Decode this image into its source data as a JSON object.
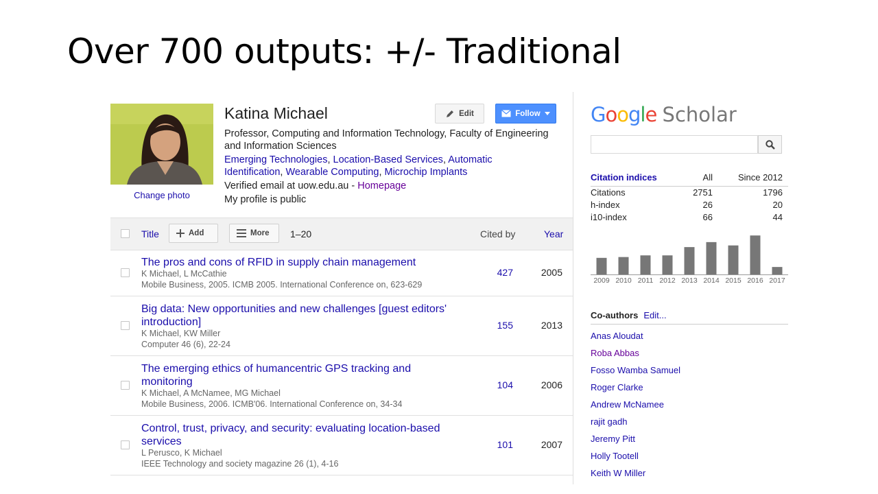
{
  "slide": {
    "title": "Over 700 outputs: +/- Traditional"
  },
  "profile": {
    "name": "Katina Michael",
    "affiliation": "Professor, Computing and Information Technology, Faculty of Engineering and Information Sciences",
    "interests": [
      "Emerging Technologies",
      "Location-Based Services",
      "Automatic Identification",
      "Wearable Computing",
      "Microchip Implants"
    ],
    "email": "Verified email at uow.edu.au",
    "email_sep": " - ",
    "homepage": "Homepage",
    "public_status": "My profile is public",
    "change_photo": "Change photo",
    "edit_label": "Edit",
    "follow_label": "Follow"
  },
  "toolbar": {
    "title_label": "Title",
    "add_label": "Add",
    "more_label": "More",
    "range": "1–20",
    "cited_by_label": "Cited by",
    "year_label": "Year"
  },
  "articles": [
    {
      "title": "The pros and cons of RFID in supply chain management",
      "authors": "K Michael, L McCathie",
      "venue": "Mobile Business, 2005. ICMB 2005. International Conference on, 623-629",
      "cited": "427",
      "year": "2005"
    },
    {
      "title": "Big data: New opportunities and new challenges [guest editors' introduction]",
      "authors": "K Michael, KW Miller",
      "venue": "Computer 46 (6), 22-24",
      "cited": "155",
      "year": "2013"
    },
    {
      "title": "The emerging ethics of humancentric GPS tracking and monitoring",
      "authors": "K Michael, A McNamee, MG Michael",
      "venue": "Mobile Business, 2006. ICMB'06. International Conference on, 34-34",
      "cited": "104",
      "year": "2006"
    },
    {
      "title": "Control, trust, privacy, and security: evaluating location-based services",
      "authors": "L Perusco, K Michael",
      "venue": "IEEE Technology and society magazine 26 (1), 4-16",
      "cited": "101",
      "year": "2007"
    }
  ],
  "scholar": {
    "logo_google": [
      "G",
      "o",
      "o",
      "g",
      "l",
      "e"
    ],
    "logo_colors": [
      "#4285f4",
      "#ea4335",
      "#fbbc05",
      "#4285f4",
      "#34a853",
      "#ea4335"
    ],
    "logo_scholar": "Scholar",
    "search_placeholder": ""
  },
  "citation_indices": {
    "header": [
      "Citation indices",
      "All",
      "Since 2012"
    ],
    "rows": [
      {
        "label": "Citations",
        "all": "2751",
        "since": "1796"
      },
      {
        "label": "h-index",
        "all": "26",
        "since": "20"
      },
      {
        "label": "i10-index",
        "all": "66",
        "since": "44"
      }
    ]
  },
  "chart_data": {
    "type": "bar",
    "categories": [
      "2009",
      "2010",
      "2011",
      "2012",
      "2013",
      "2014",
      "2015",
      "2016",
      "2017"
    ],
    "values": [
      100,
      105,
      115,
      115,
      165,
      195,
      175,
      235,
      45
    ],
    "ylim": [
      0,
      240
    ],
    "bar_color": "#777777",
    "grid": false
  },
  "coauthors": {
    "title": "Co-authors",
    "edit_label": "Edit...",
    "names": [
      "Anas Aloudat",
      "Roba Abbas",
      "Fosso Wamba Samuel",
      "Roger Clarke",
      "Andrew McNamee",
      "rajit gadh",
      "Jeremy Pitt",
      "Holly Tootell",
      "Keith W Miller"
    ],
    "visited": [
      false,
      true,
      false,
      false,
      false,
      false,
      false,
      false,
      false
    ]
  },
  "colors": {
    "link": "#1a0dab",
    "visited": "#660099",
    "follow": "#4d90fe"
  }
}
